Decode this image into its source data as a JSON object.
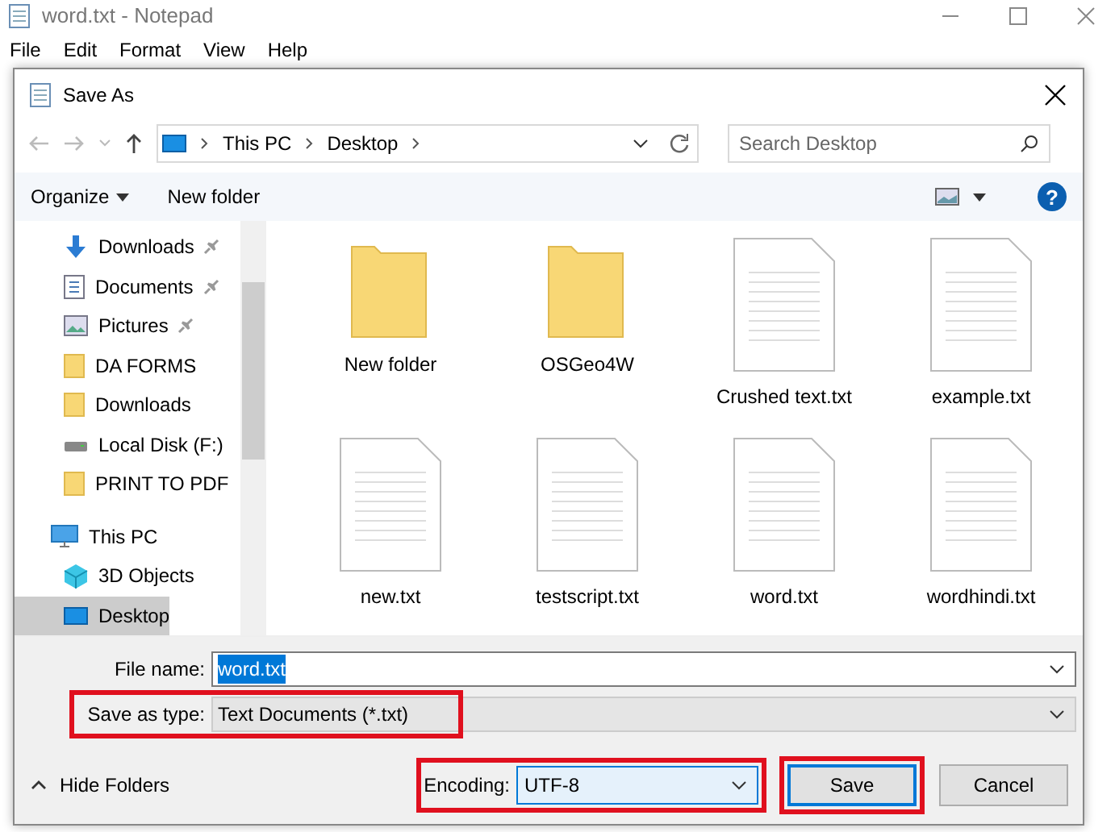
{
  "window": {
    "title": "word.txt - Notepad"
  },
  "menu": [
    "File",
    "Edit",
    "Format",
    "View",
    "Help"
  ],
  "dialog": {
    "title": "Save As",
    "breadcrumb": [
      "This PC",
      "Desktop"
    ],
    "search": {
      "placeholder": "Search Desktop"
    },
    "toolbar": {
      "organize": "Organize",
      "new_folder": "New folder",
      "help": "?"
    },
    "sidebar": {
      "items": [
        {
          "label": "Downloads",
          "kind": "download",
          "pinned": true,
          "selected": false
        },
        {
          "label": "Documents",
          "kind": "document",
          "pinned": true,
          "selected": false
        },
        {
          "label": "Pictures",
          "kind": "picture",
          "pinned": true,
          "selected": false
        },
        {
          "label": "DA FORMS",
          "kind": "folder",
          "pinned": false,
          "selected": false
        },
        {
          "label": "Downloads",
          "kind": "folder",
          "pinned": false,
          "selected": false
        },
        {
          "label": "Local Disk (F:)",
          "kind": "drive",
          "pinned": false,
          "selected": false
        },
        {
          "label": "PRINT TO PDF",
          "kind": "folder",
          "pinned": false,
          "selected": false
        },
        {
          "label": "This PC",
          "kind": "pc",
          "pinned": false,
          "selected": false
        },
        {
          "label": "3D Objects",
          "kind": "cube",
          "pinned": false,
          "selected": false
        },
        {
          "label": "Desktop",
          "kind": "desktop",
          "pinned": false,
          "selected": true
        }
      ]
    },
    "files": [
      {
        "name": "New folder",
        "kind": "folder"
      },
      {
        "name": "OSGeo4W",
        "kind": "folder"
      },
      {
        "name": "Crushed text.txt",
        "kind": "text"
      },
      {
        "name": "example.txt",
        "kind": "text"
      },
      {
        "name": "new.txt",
        "kind": "text"
      },
      {
        "name": "testscript.txt",
        "kind": "text"
      },
      {
        "name": "word.txt",
        "kind": "text"
      },
      {
        "name": "wordhindi.txt",
        "kind": "text"
      }
    ],
    "file_name": {
      "label": "File name:",
      "value": "word.txt"
    },
    "save_as_type": {
      "label": "Save as type:",
      "value": "Text Documents (*.txt)",
      "highlighted": true
    },
    "hide_folders": "Hide Folders",
    "encoding": {
      "label": "Encoding:",
      "value": "UTF-8",
      "highlighted": true
    },
    "buttons": [
      {
        "label": "Save",
        "highlighted": true
      },
      {
        "label": "Cancel",
        "highlighted": false
      }
    ]
  }
}
